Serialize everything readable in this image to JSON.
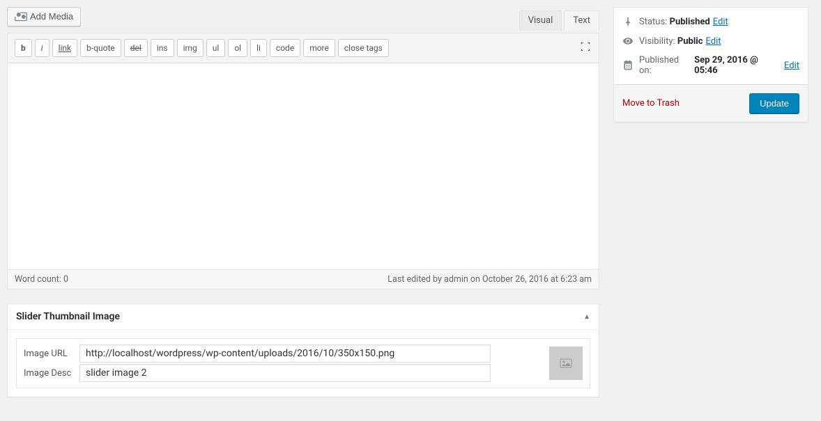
{
  "toolbar": {
    "add_media_label": "Add Media"
  },
  "editor": {
    "tabs": {
      "visual": "Visual",
      "text": "Text"
    },
    "quicktags": [
      "b",
      "i",
      "link",
      "b-quote",
      "del",
      "ins",
      "img",
      "ul",
      "ol",
      "li",
      "code",
      "more",
      "close tags"
    ],
    "word_count_label": "Word count: 0",
    "last_edited": "Last edited by admin on October 26, 2016 at 6:23 am"
  },
  "metabox": {
    "title": "Slider Thumbnail Image",
    "image_url_label": "Image URL",
    "image_url_value": "http://localhost/wordpress/wp-content/uploads/2016/10/350x150.png",
    "image_desc_label": "Image Desc",
    "image_desc_value": "slider image 2"
  },
  "publish": {
    "status_label": "Status:",
    "status_value": "Published",
    "visibility_label": "Visibility:",
    "visibility_value": "Public",
    "published_label": "Published on:",
    "published_value": "Sep 29, 2016 @ 05:46",
    "edit_link": "Edit",
    "trash_label": "Move to Trash",
    "update_label": "Update"
  }
}
